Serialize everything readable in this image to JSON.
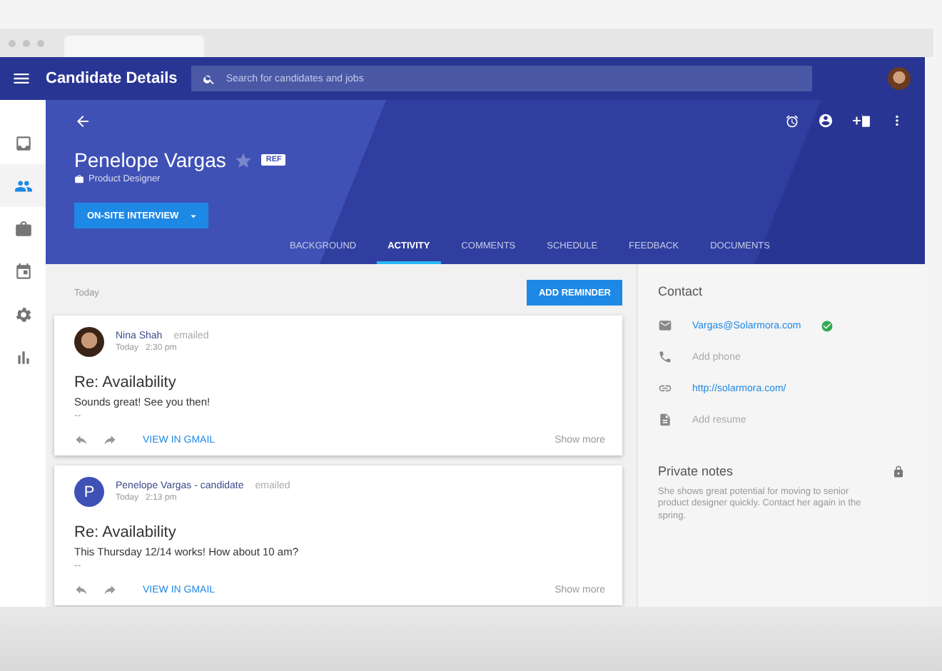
{
  "app_bar": {
    "title": "Candidate Details",
    "search_placeholder": "Search for candidates and jobs"
  },
  "sidebar": {
    "items": [
      {
        "kind": "inbox",
        "selected": false
      },
      {
        "kind": "people",
        "selected": true
      },
      {
        "kind": "briefcase",
        "selected": false
      },
      {
        "kind": "calendar",
        "selected": false
      },
      {
        "kind": "settings",
        "selected": false
      },
      {
        "kind": "chart",
        "selected": false
      }
    ]
  },
  "candidate": {
    "name": "Penelope Vargas",
    "starred": false,
    "badge": "REF",
    "role": "Product Designer",
    "stage_button": "ON-SITE INTERVIEW"
  },
  "tabs": [
    {
      "label": "BACKGROUND",
      "selected": false
    },
    {
      "label": "ACTIVITY",
      "selected": true
    },
    {
      "label": "COMMENTS",
      "selected": false
    },
    {
      "label": "SCHEDULE",
      "selected": false
    },
    {
      "label": "FEEDBACK",
      "selected": false
    },
    {
      "label": "DOCUMENTS",
      "selected": false
    }
  ],
  "activity": {
    "date_label": "Today",
    "add_button": "ADD REMINDER",
    "emails": [
      {
        "kind": "photo",
        "sender": "Nina Shah",
        "action": "emailed",
        "date": "Today",
        "time": "2:30 pm",
        "subject": "Re: Availability",
        "body": "Sounds great! See you then!",
        "signature": "--",
        "link": "VIEW IN GMAIL",
        "more": "Show more"
      },
      {
        "kind": "letter",
        "initial": "P",
        "sender": "Penelope Vargas - candidate",
        "action": "emailed",
        "date": "Today",
        "time": "2:13 pm",
        "subject": "Re: Availability",
        "body": "This Thursday 12/14 works! How about 10 am?",
        "signature": "--",
        "link": "VIEW IN GMAIL",
        "more": "Show more"
      }
    ]
  },
  "contact": {
    "title": "Contact",
    "items": [
      {
        "kind": "email",
        "text": "Vargas@Solarmora.com",
        "empty": false,
        "verified": true
      },
      {
        "kind": "phone",
        "text": "Add phone",
        "empty": true,
        "verified": false
      },
      {
        "kind": "website",
        "text": "http://solarmora.com/",
        "empty": false,
        "verified": false
      },
      {
        "kind": "resume",
        "text": "Add resume",
        "empty": true,
        "verified": false
      }
    ]
  },
  "notes": {
    "title": "Private notes",
    "locked": true,
    "text": "She shows great potential for moving to senior product designer quickly. Contact her again in the spring."
  }
}
